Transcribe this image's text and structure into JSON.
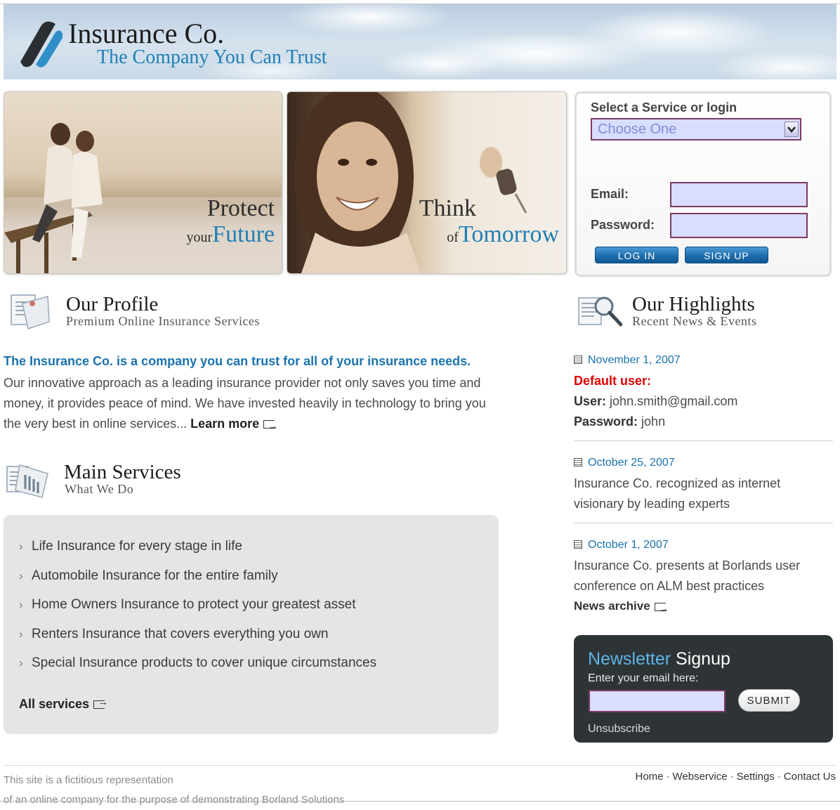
{
  "header": {
    "title": "Insurance Co.",
    "tagline": "The Company You Can Trust"
  },
  "banners": [
    {
      "word1": "Protect",
      "small": "your",
      "word2": "Future"
    },
    {
      "word1": "Think",
      "small": "of",
      "word2": "Tomorrow"
    }
  ],
  "login": {
    "title": "Select a Service or login",
    "service_select": "Choose One",
    "email_label": "Email:",
    "password_label": "Password:",
    "login_button": "LOG IN",
    "signup_button": "SIGN UP"
  },
  "profile": {
    "title": "Our Profile",
    "subtitle": "Premium Online Insurance Services",
    "lead": "The Insurance Co. is a company you can trust for all of your insurance needs.",
    "body": "Our innovative approach as a leading insurance provider not only saves you time and money, it provides peace of mind. We have invested heavily in technology to bring you the very best in online services...",
    "learn_more": "Learn more"
  },
  "services": {
    "title": "Main Services",
    "subtitle": "What We Do",
    "items": [
      "Life Insurance for every stage in life",
      "Automobile Insurance for the entire family",
      "Home Owners Insurance to protect your greatest asset",
      "Renters Insurance that covers everything you own",
      "Special Insurance products to cover unique circumstances"
    ],
    "all_link": "All services"
  },
  "highlights": {
    "title": "Our Highlights",
    "subtitle": "Recent News & Events",
    "news": [
      {
        "date": "November 1, 2007",
        "heading": "Default user:",
        "user_label": "User:",
        "user_value": "john.smith@gmail.com",
        "password_label": "Password:",
        "password_value": "john"
      },
      {
        "date": "October 25, 2007",
        "text": "Insurance Co. recognized as internet visionary by leading experts"
      },
      {
        "date": "October 1, 2007",
        "text": "Insurance Co. presents at Borlands user conference on ALM best practices"
      }
    ],
    "archive_link": "News archive"
  },
  "newsletter": {
    "title_a": "Newsletter",
    "title_b": "Signup",
    "prompt": "Enter your email here:",
    "submit": "SUBMIT",
    "unsubscribe": "Unsubscribe"
  },
  "footer": {
    "line1": "This site is a fictitious representation",
    "line2": "of an online company for the purpose of demonstrating Borland Solutions",
    "links": [
      "Home",
      "Webservice",
      "Settings",
      "Contact Us"
    ]
  },
  "colors": {
    "accent_blue": "#1f7fb6",
    "link_blue": "#1b73ad",
    "alert_red": "#e00000",
    "input_fill": "#d9ddff",
    "input_border": "#7c3a63",
    "newsletter_bg": "#2e3436"
  }
}
